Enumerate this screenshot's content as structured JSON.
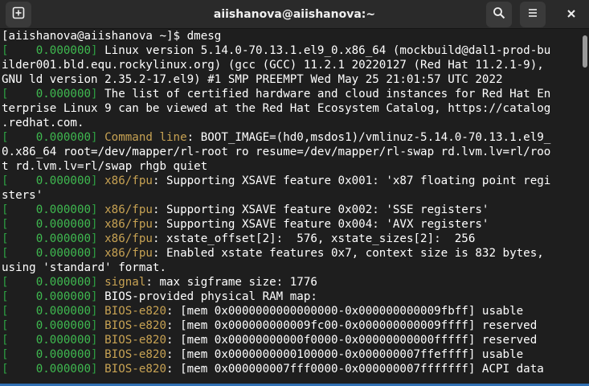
{
  "window": {
    "title": "aiishanova@aiishanova:~",
    "new_tab_icon": "new-tab-icon",
    "search_icon": "search-icon",
    "menu_icon": "hamburger-menu-icon",
    "close_icon": "close-icon"
  },
  "colors": {
    "bracket": "#2ea043",
    "timestamp": "#3fb950",
    "subsystem": "#c7a253",
    "text": "#ffffff",
    "background": "#1e1e1e"
  },
  "terminal": {
    "prompt": "[aiishanova@aiishanova ~]$ dmesg",
    "lines": [
      {
        "br_open": "[",
        "ts": "    0.000000",
        "br_close": "]",
        "sub": "",
        "text": " Linux version 5.14.0-70.13.1.el9_0.x86_64 (mockbuild@dal1-prod-bu"
      },
      {
        "br_open": "",
        "ts": "",
        "br_close": "",
        "sub": "",
        "text": "ilder001.bld.equ.rockylinux.org) (gcc (GCC) 11.2.1 20220127 (Red Hat 11.2.1-9),"
      },
      {
        "br_open": "",
        "ts": "",
        "br_close": "",
        "sub": "",
        "text": "GNU ld version 2.35.2-17.el9) #1 SMP PREEMPT Wed May 25 21:01:57 UTC 2022"
      },
      {
        "br_open": "[",
        "ts": "    0.000000",
        "br_close": "]",
        "sub": "",
        "text": " The list of certified hardware and cloud instances for Red Hat En"
      },
      {
        "br_open": "",
        "ts": "",
        "br_close": "",
        "sub": "",
        "text": "terprise Linux 9 can be viewed at the Red Hat Ecosystem Catalog, https://catalog"
      },
      {
        "br_open": "",
        "ts": "",
        "br_close": "",
        "sub": "",
        "text": ".redhat.com."
      },
      {
        "br_open": "[",
        "ts": "    0.000000",
        "br_close": "]",
        "sub": " Command line",
        "text": ": BOOT_IMAGE=(hd0,msdos1)/vmlinuz-5.14.0-70.13.1.el9_"
      },
      {
        "br_open": "",
        "ts": "",
        "br_close": "",
        "sub": "",
        "text": "0.x86_64 root=/dev/mapper/rl-root ro resume=/dev/mapper/rl-swap rd.lvm.lv=rl/roo"
      },
      {
        "br_open": "",
        "ts": "",
        "br_close": "",
        "sub": "",
        "text": "t rd.lvm.lv=rl/swap rhgb quiet"
      },
      {
        "br_open": "[",
        "ts": "    0.000000",
        "br_close": "]",
        "sub": " x86/fpu",
        "text": ": Supporting XSAVE feature 0x001: 'x87 floating point regi"
      },
      {
        "br_open": "",
        "ts": "",
        "br_close": "",
        "sub": "",
        "text": "sters'"
      },
      {
        "br_open": "[",
        "ts": "    0.000000",
        "br_close": "]",
        "sub": " x86/fpu",
        "text": ": Supporting XSAVE feature 0x002: 'SSE registers'"
      },
      {
        "br_open": "[",
        "ts": "    0.000000",
        "br_close": "]",
        "sub": " x86/fpu",
        "text": ": Supporting XSAVE feature 0x004: 'AVX registers'"
      },
      {
        "br_open": "[",
        "ts": "    0.000000",
        "br_close": "]",
        "sub": " x86/fpu",
        "text": ": xstate_offset[2]:  576, xstate_sizes[2]:  256"
      },
      {
        "br_open": "[",
        "ts": "    0.000000",
        "br_close": "]",
        "sub": " x86/fpu",
        "text": ": Enabled xstate features 0x7, context size is 832 bytes,"
      },
      {
        "br_open": "",
        "ts": "",
        "br_close": "",
        "sub": "",
        "text": "using 'standard' format."
      },
      {
        "br_open": "[",
        "ts": "    0.000000",
        "br_close": "]",
        "sub": " signal",
        "text": ": max sigframe size: 1776"
      },
      {
        "br_open": "[",
        "ts": "    0.000000",
        "br_close": "]",
        "sub": "",
        "text": " BIOS-provided physical RAM map:"
      },
      {
        "br_open": "[",
        "ts": "    0.000000",
        "br_close": "]",
        "sub": " BIOS-e820",
        "text": ": [mem 0x0000000000000000-0x000000000009fbff] usable"
      },
      {
        "br_open": "[",
        "ts": "    0.000000",
        "br_close": "]",
        "sub": " BIOS-e820",
        "text": ": [mem 0x000000000009fc00-0x000000000009ffff] reserved"
      },
      {
        "br_open": "[",
        "ts": "    0.000000",
        "br_close": "]",
        "sub": " BIOS-e820",
        "text": ": [mem 0x00000000000f0000-0x00000000000fffff] reserved"
      },
      {
        "br_open": "[",
        "ts": "    0.000000",
        "br_close": "]",
        "sub": " BIOS-e820",
        "text": ": [mem 0x0000000000100000-0x000000007ffeffff] usable"
      },
      {
        "br_open": "[",
        "ts": "    0.000000",
        "br_close": "]",
        "sub": " BIOS-e820",
        "text": ": [mem 0x000000007fff0000-0x000000007fffffff] ACPI data"
      }
    ]
  }
}
